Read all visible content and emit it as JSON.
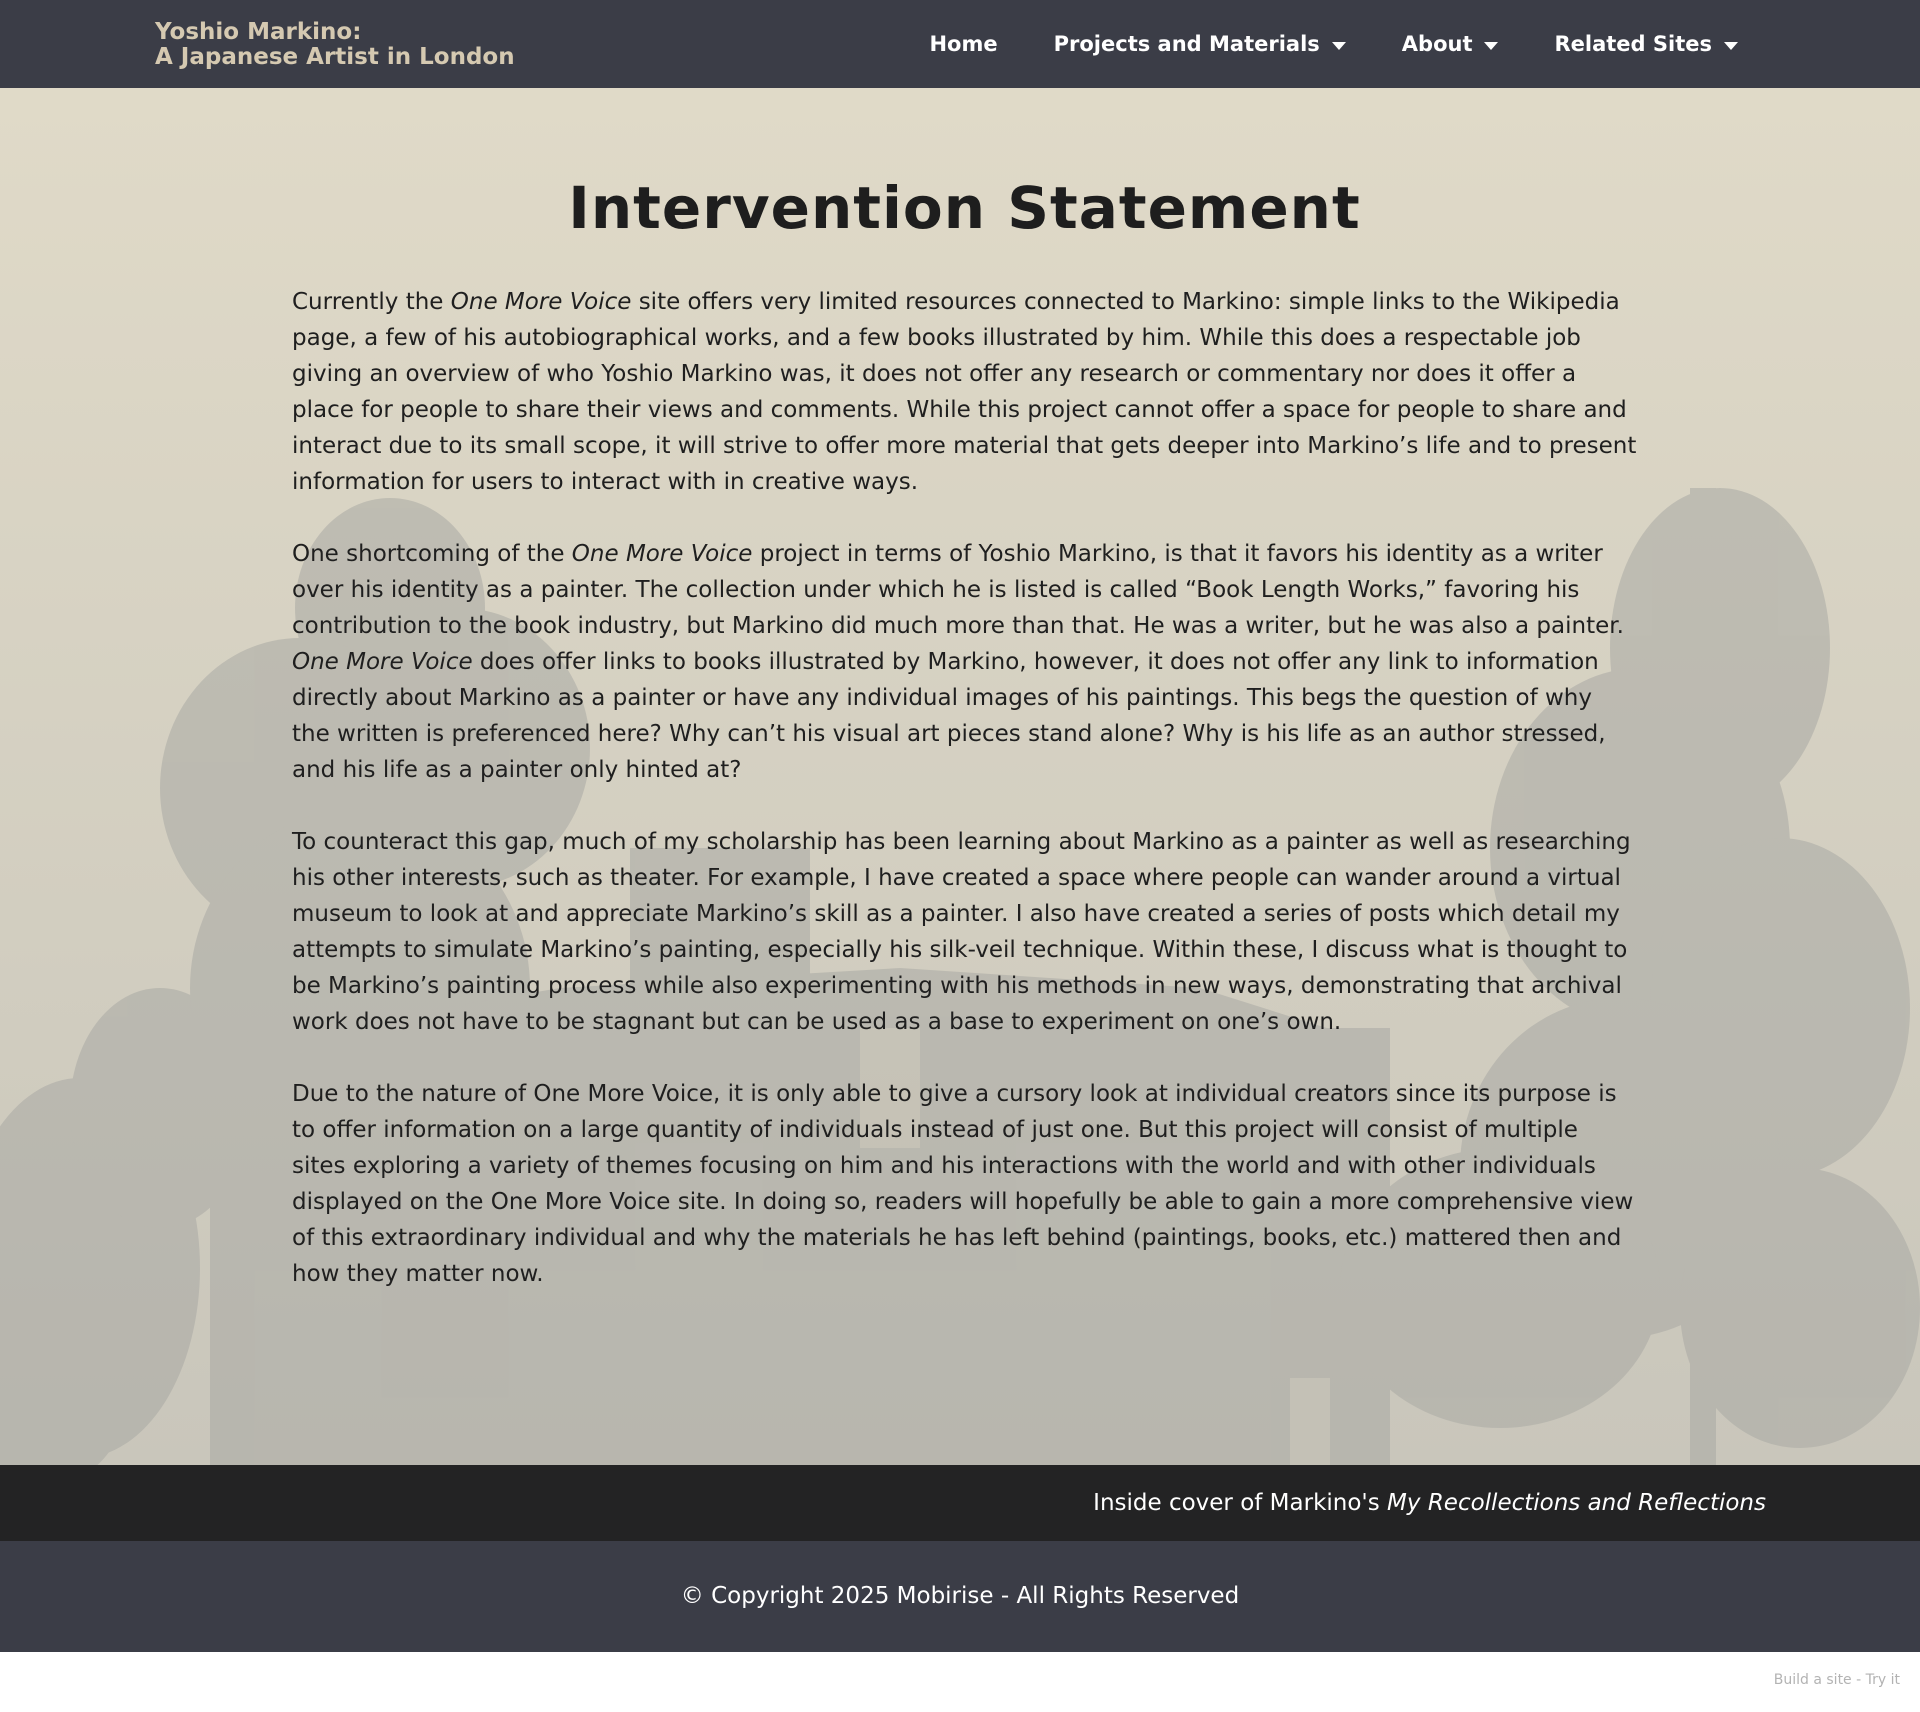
{
  "navbar": {
    "brand_line1": "Yoshio Markino:",
    "brand_line2": "A Japanese Artist in London",
    "brand_color": "#d5c9b1",
    "background": "#3b3d47",
    "items": [
      {
        "label": "Home",
        "has_dropdown": false
      },
      {
        "label": "Projects and Materials",
        "has_dropdown": true
      },
      {
        "label": "About",
        "has_dropdown": true
      },
      {
        "label": "Related Sites",
        "has_dropdown": true
      }
    ]
  },
  "main": {
    "title": "Intervention Statement",
    "paragraphs": [
      {
        "p1a": "Currently the ",
        "p1b": "One More Voice",
        "p1c": " site offers very limited resources connected to Markino: simple links to the Wikipedia page, a few of his autobiographical works, and a few books illustrated by him. While this does a respectable job giving an overview of who Yoshio Markino was, it does not offer any research or commentary nor does it offer a place for people to share their views and comments. While this project cannot offer a space for people to share and interact due to its small scope, it will strive to offer more material that gets deeper into Markino’s life and to present information for users to interact with in creative ways."
      },
      {
        "p2a": "One shortcoming of the ",
        "p2b": "One More Voice",
        "p2c": " project in terms of Yoshio Markino, is that it favors his identity as a writer over his identity as a painter. The collection under which he is listed is called “Book Length Works,” favoring his contribution to the book industry, but Markino did much more than that. He was a writer, but he was also a painter. ",
        "p2d": "One More Voice",
        "p2e": " does offer links to books illustrated by Markino, however, it does not offer any link to information directly about Markino as a painter or have any individual images of his paintings. This begs the question of why the written is preferenced here? Why can’t his visual art pieces stand alone? Why is his life as an author stressed, and his life as a painter only hinted at?"
      },
      {
        "text": "To counteract this gap, much of my scholarship has been learning about Markino as a painter as well as researching his other interests, such as theater. For example, I have created a space where people can wander around a virtual museum to look at and appreciate Markino’s skill as a painter. I also have created a series of posts which detail my attempts to simulate Markino’s painting, especially his silk-veil technique. Within these, I discuss what is thought to be Markino’s painting process while also experimenting with his methods in new ways, demonstrating that archival work does not have to be stagnant but can be used as a base to experiment on one’s own."
      },
      {
        "text": "Due to the nature of One More Voice, it is only able to give a cursory look at individual creators since its purpose is to offer information on a large quantity of individuals instead of just one. But this project will consist of multiple sites exploring a variety of themes focusing on him and his interactions with the world and with other individuals displayed on the One More Voice site. In doing so, readers will hopefully be able to gain a more comprehensive view of this extraordinary individual and why the materials he has left behind (paintings, books, etc.) mattered then and how they matter now."
      }
    ]
  },
  "caption": {
    "prefix": "Inside cover of Markino's ",
    "title": "My Recollections and Reflections"
  },
  "footer": {
    "copyright": "© Copyright 2025 Mobirise - All Rights Reserved"
  },
  "badge": {
    "text": "Build a site - Try it"
  },
  "icons": {
    "dropdown": "caret-down-icon"
  }
}
